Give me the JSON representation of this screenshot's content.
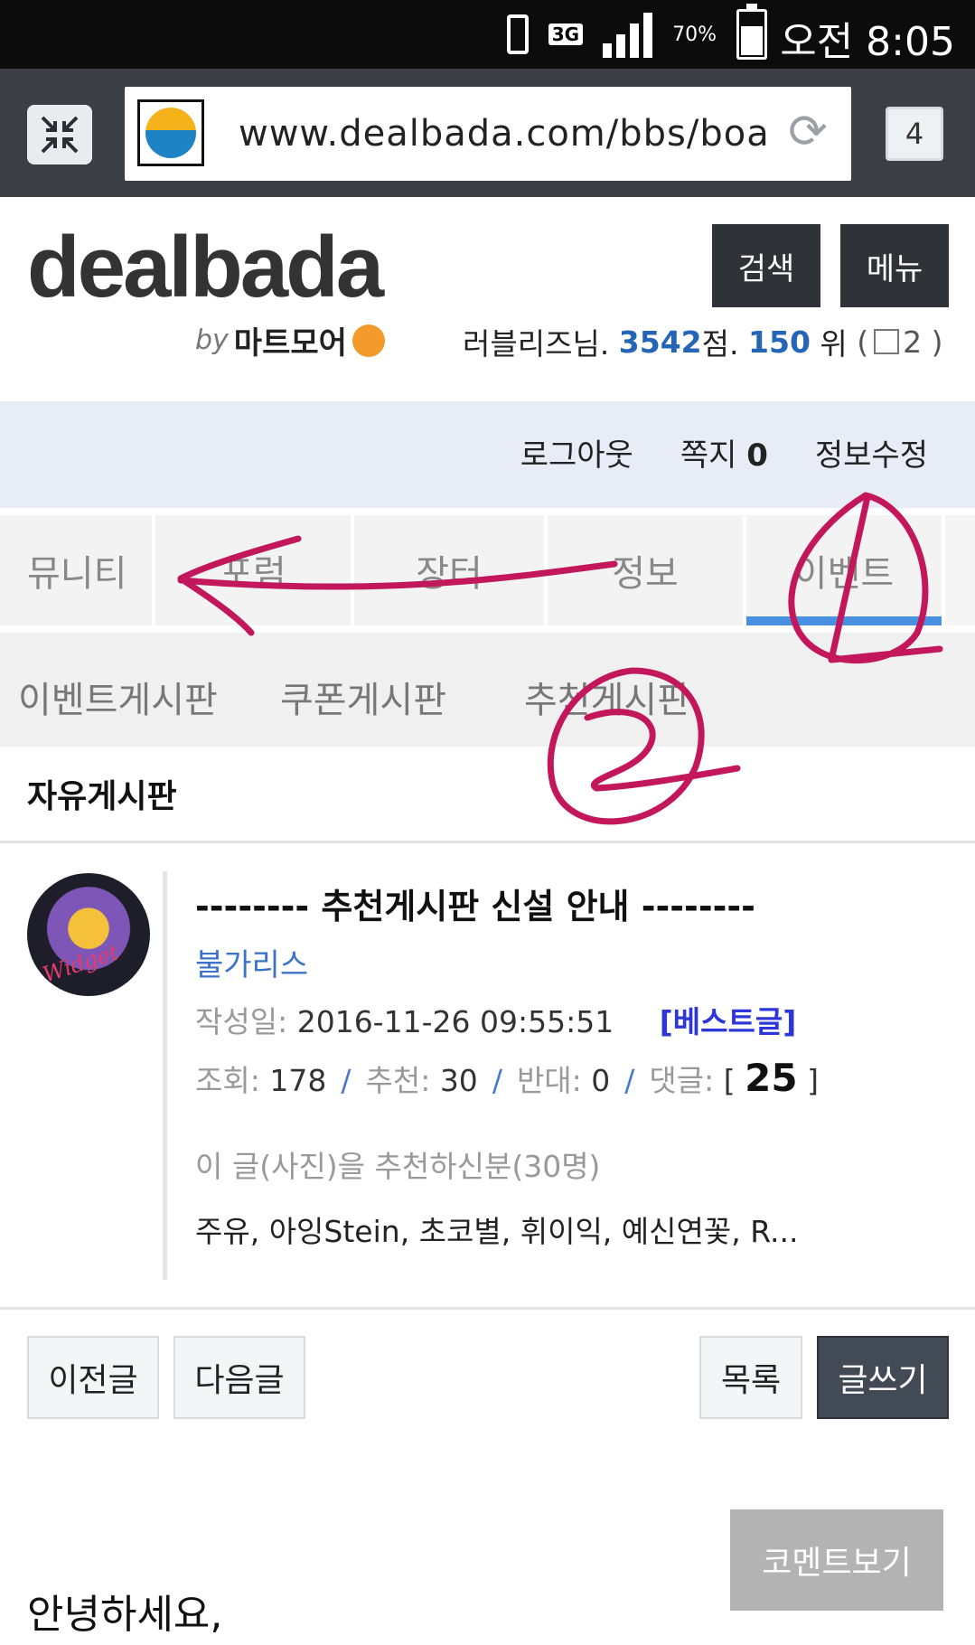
{
  "status_bar": {
    "network": "3G",
    "battery_pct": "70%",
    "battery_level": 0.7,
    "time": "오전 8:05",
    "signal_bars": 4
  },
  "browser": {
    "url": "www.dealbada.com/bbs/boa",
    "tab_count": "4"
  },
  "site": {
    "logo": "dealbada",
    "logo_by": "by",
    "logo_brand": "마트모어",
    "search_label": "검색",
    "menu_label": "메뉴",
    "user": {
      "name": "러블리즈님.",
      "points": "3542",
      "points_unit": "점.",
      "rank": "150",
      "rank_unit": "위",
      "paren_open": "(",
      "messages": "2",
      "paren_close": ")"
    },
    "user_links": {
      "logout": "로그아웃",
      "memo_label": "쪽지",
      "memo_count": "0",
      "edit_info": "정보수정"
    }
  },
  "main_nav": {
    "tabs": [
      {
        "label": "뮤니티"
      },
      {
        "label": "포럼"
      },
      {
        "label": "장터"
      },
      {
        "label": "정보"
      },
      {
        "label": "이벤트",
        "active": true
      }
    ]
  },
  "sub_nav": {
    "items": [
      {
        "label": "이벤트게시판"
      },
      {
        "label": "쿠폰게시판"
      },
      {
        "label": "추천게시판"
      }
    ]
  },
  "board_title": "자유게시판",
  "post": {
    "title": "-------- 추천게시판 신설 안내 --------",
    "author": "불가리스",
    "avatar_text": "Widget",
    "date_label": "작성일:",
    "date": "2016-11-26 09:55:51",
    "best_tag": "[베스트글]",
    "views_label": "조회:",
    "views": "178",
    "recommend_label": "추천:",
    "recommend": "30",
    "oppose_label": "반대:",
    "oppose": "0",
    "comments_label": "댓글:",
    "comments_open": "[",
    "comments": "25",
    "comments_close": "]",
    "separator": "/",
    "recommenders_title": "이 글(사진)을 추천하신분(30명)",
    "recommenders": "주유, 아잉Stein, 초코별, 휘이익, 예신연꽃, R..."
  },
  "buttons": {
    "prev": "이전글",
    "next": "다음글",
    "list": "목록",
    "write": "글쓰기",
    "view_comments": "코멘트보기"
  },
  "body_text": "안녕하세요,",
  "colors": {
    "accent_blue": "#4a90e2",
    "annotation": "#c2185b",
    "dark_button": "#2f3338"
  }
}
